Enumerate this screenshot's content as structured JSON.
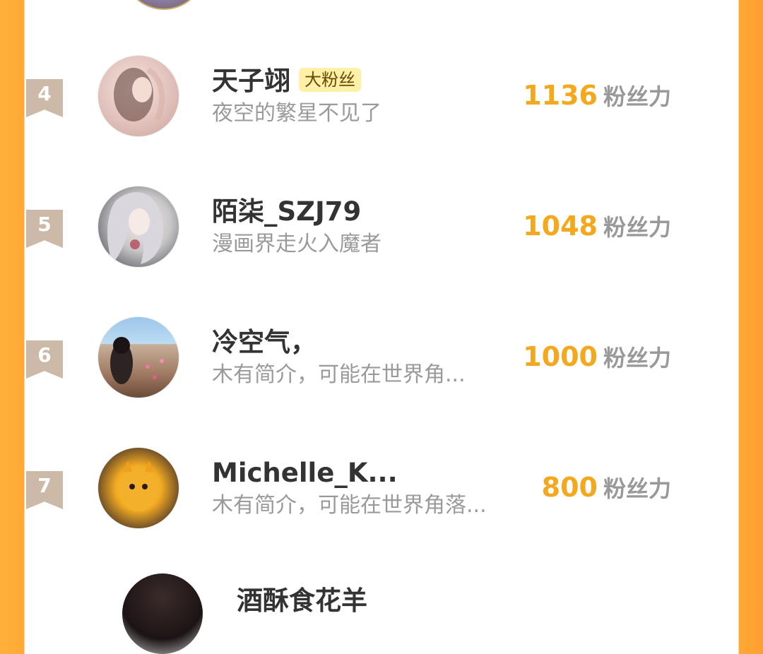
{
  "rankings": [
    {
      "rank": "4",
      "name": "天子翊",
      "badge": "大粉丝",
      "bio": "夜空的繁星不见了",
      "score": "1136",
      "unit": "粉丝力"
    },
    {
      "rank": "5",
      "name": "陌柒_SZJ79",
      "badge": "",
      "bio": "漫画界走火入魔者",
      "score": "1048",
      "unit": "粉丝力"
    },
    {
      "rank": "6",
      "name": "冷空气，",
      "badge": "",
      "bio": "木有简介，可能在世界角...",
      "score": "1000",
      "unit": "粉丝力"
    },
    {
      "rank": "7",
      "name": "Michelle_K...",
      "badge": "",
      "bio": "木有简介，可能在世界角落...",
      "score": "800",
      "unit": "粉丝力"
    }
  ],
  "next_row": {
    "name": "酒酥食花羊"
  }
}
